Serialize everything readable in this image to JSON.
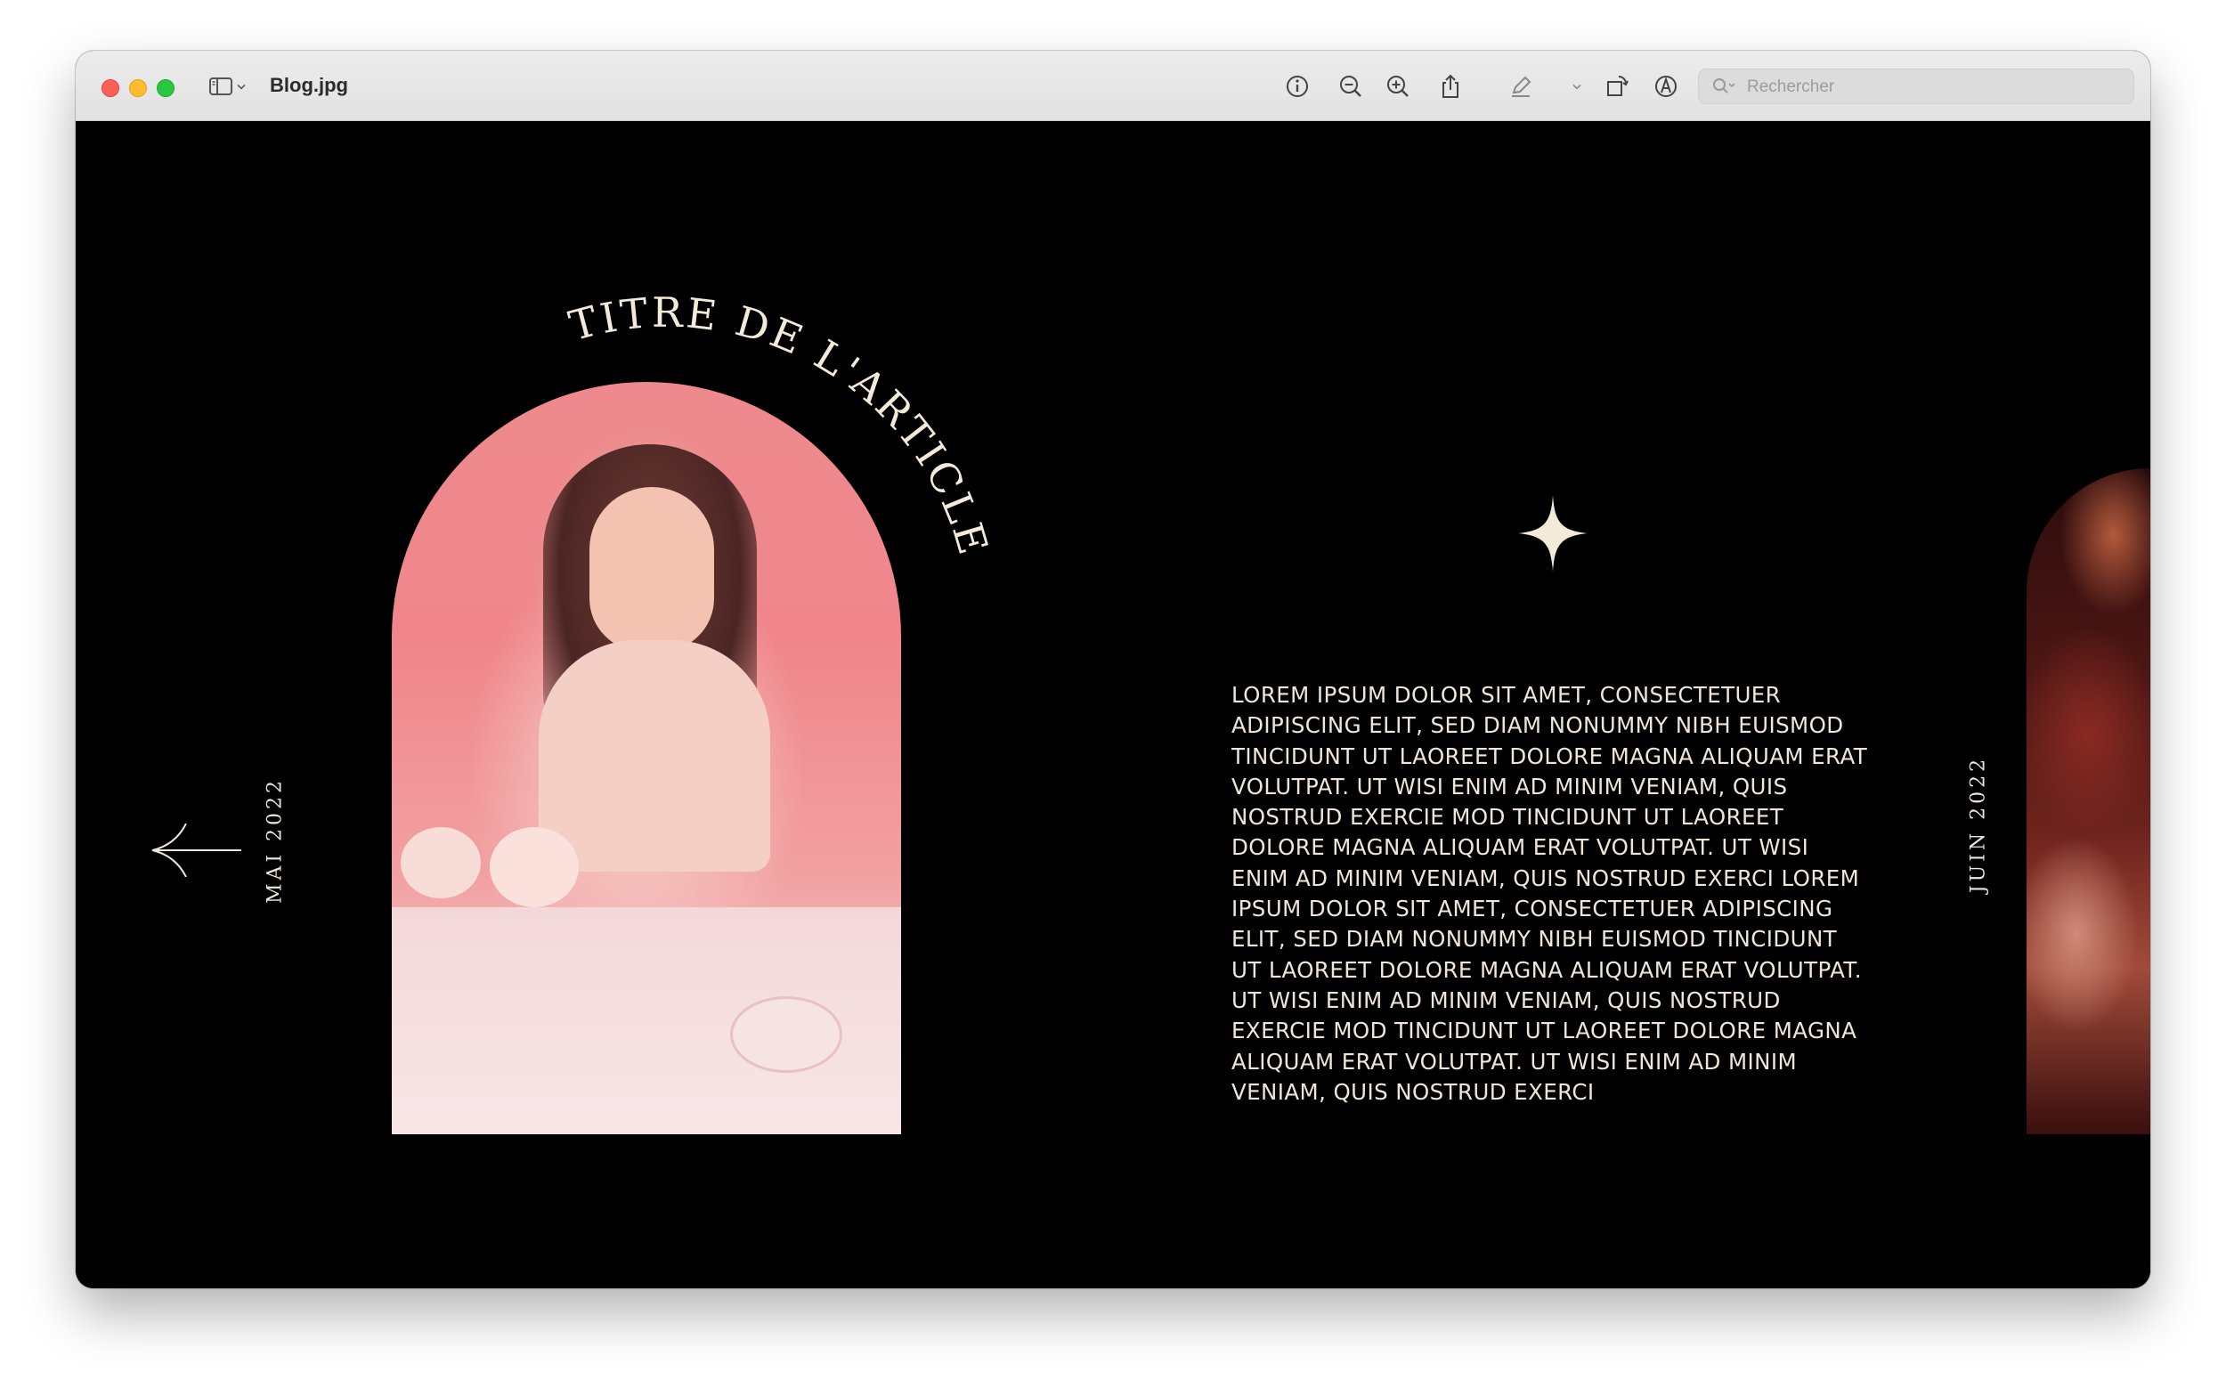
{
  "window": {
    "title": "Blog.jpg",
    "search_placeholder": "Rechercher"
  },
  "toolbar": {
    "icons": [
      "sidebar-icon",
      "chevron-down-icon",
      "info-icon",
      "zoom-out-icon",
      "zoom-in-icon",
      "share-icon",
      "markup-pen-icon",
      "chevron-down-icon",
      "rotate-icon",
      "annotate-icon",
      "search-icon"
    ]
  },
  "article": {
    "title": "TITRE DE L'ARTICLE",
    "date_current": "MAI 2022",
    "date_next": "JUIN 2022",
    "body": "Lorem ipsum dolor sit amet, consectetuer adipiscing elit, sed diam nonummy nibh euismod tincidunt ut laoreet dolore magna aliquam erat volutpat. Ut wisi enim ad minim veniam, quis nostrud exercie mod tincidunt ut laoreet dolore magna aliquam erat volutpat. Ut wisi enim ad minim veniam, quis nostrud exerci lorem ipsum dolor sit amet, consectetuer adipiscing elit, sed diam nonummy nibh euismod tincidunt ut laoreet dolore magna aliquam erat volutpat. Ut wisi enim ad minim veniam, quis nostrud exercie mod tincidunt ut laoreet dolore magna aliquam erat volutpat. Ut wisi enim ad minim veniam, quis nostrud exerci"
  },
  "colors": {
    "background": "#000000",
    "text_cream": "#efe6d8",
    "titlebar": "#e6e6e6"
  }
}
